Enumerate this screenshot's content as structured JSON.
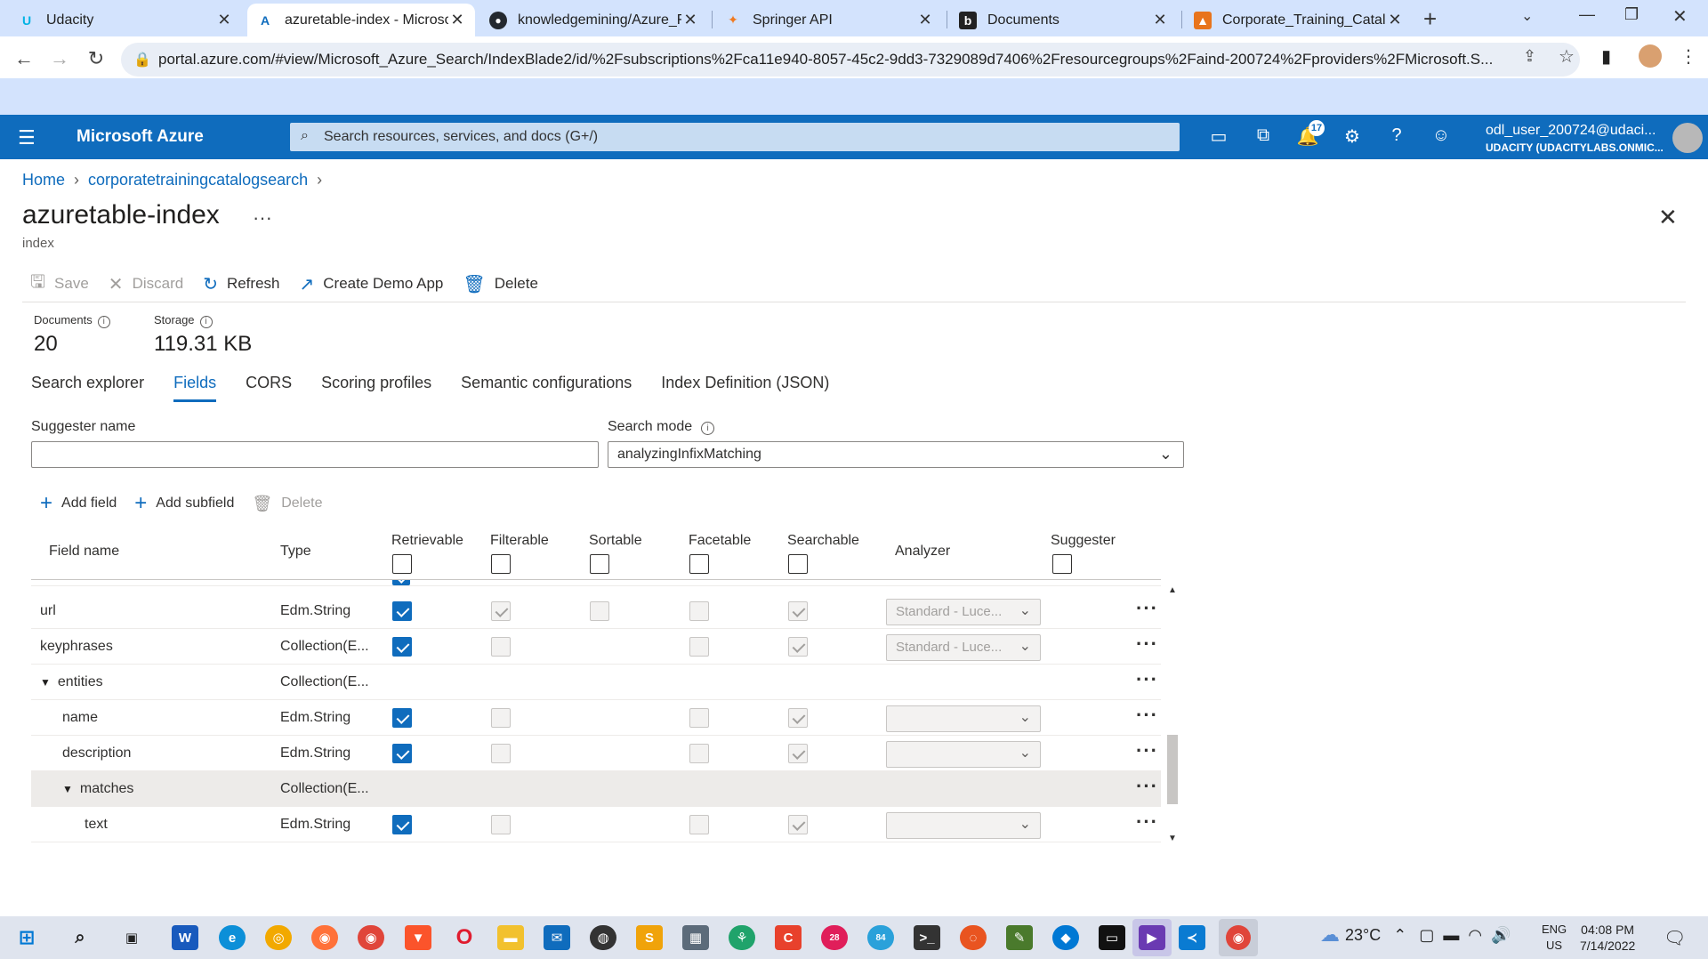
{
  "browser": {
    "tabs": [
      {
        "title": "Udacity",
        "icon": "udacity-icon",
        "color": "#02b3e4"
      },
      {
        "title": "azuretable-index - Microso",
        "icon": "azure-icon",
        "color": "#0f6cbd"
      },
      {
        "title": "knowledgemining/Azure_Fu",
        "icon": "github-icon",
        "color": "#24292f"
      },
      {
        "title": "Springer API",
        "icon": "springer-icon",
        "color": "#f07a21"
      },
      {
        "title": "Documents",
        "icon": "documents-icon",
        "color": "#222"
      },
      {
        "title": "Corporate_Training_Catalog",
        "icon": "catalog-icon",
        "color": "#e8741c"
      }
    ],
    "url": "portal.azure.com/#view/Microsoft_Azure_Search/IndexBlade2/id/%2Fsubscriptions%2Fca11e940-8057-45c2-9dd3-7329089d7406%2Fresourcegroups%2Faind-200724%2Fproviders%2FMicrosoft.S..."
  },
  "azure": {
    "brand": "Microsoft Azure",
    "search_placeholder": "Search resources, services, and docs (G+/)",
    "notification_count": "17",
    "user_name": "odl_user_200724@udaci...",
    "user_org": "UDACITY (UDACITYLABS.ONMIC..."
  },
  "breadcrumb": {
    "home": "Home",
    "service": "corporatetrainingcatalogsearch"
  },
  "page": {
    "title": "azuretable-index",
    "subtitle": "index",
    "more": "···"
  },
  "commands": {
    "save": "Save",
    "discard": "Discard",
    "refresh": "Refresh",
    "create_demo": "Create Demo App",
    "delete": "Delete"
  },
  "stats": {
    "documents_label": "Documents",
    "documents_value": "20",
    "storage_label": "Storage",
    "storage_value": "119.31 KB"
  },
  "tabs": {
    "search_explorer": "Search explorer",
    "fields": "Fields",
    "cors": "CORS",
    "scoring": "Scoring profiles",
    "semantic": "Semantic configurations",
    "definition": "Index Definition (JSON)"
  },
  "suggester": {
    "label": "Suggester name",
    "value": ""
  },
  "search_mode": {
    "label": "Search mode",
    "value": "analyzingInfixMatching"
  },
  "field_commands": {
    "add_field": "Add field",
    "add_subfield": "Add subfield",
    "delete": "Delete"
  },
  "grid": {
    "headers": {
      "field_name": "Field name",
      "type": "Type",
      "retrievable": "Retrievable",
      "filterable": "Filterable",
      "sortable": "Sortable",
      "facetable": "Facetable",
      "searchable": "Searchable",
      "analyzer": "Analyzer",
      "suggester": "Suggester"
    },
    "rows": [
      {
        "name": "url",
        "type": "Edm.String",
        "analyzer": "Standard - Luce..."
      },
      {
        "name": "keyphrases",
        "type": "Collection(E...",
        "analyzer": "Standard - Luce..."
      },
      {
        "name": "entities",
        "type": "Collection(E..."
      },
      {
        "name": "name",
        "type": "Edm.String",
        "analyzer": ""
      },
      {
        "name": "description",
        "type": "Edm.String",
        "analyzer": ""
      },
      {
        "name": "matches",
        "type": "Collection(E..."
      },
      {
        "name": "text",
        "type": "Edm.String",
        "analyzer": ""
      }
    ]
  },
  "taskbar": {
    "weather": "23°C",
    "lang1": "ENG",
    "lang2": "US",
    "time": "04:08 PM",
    "date": "7/14/2022",
    "badge1": "28",
    "badge2": "84"
  }
}
